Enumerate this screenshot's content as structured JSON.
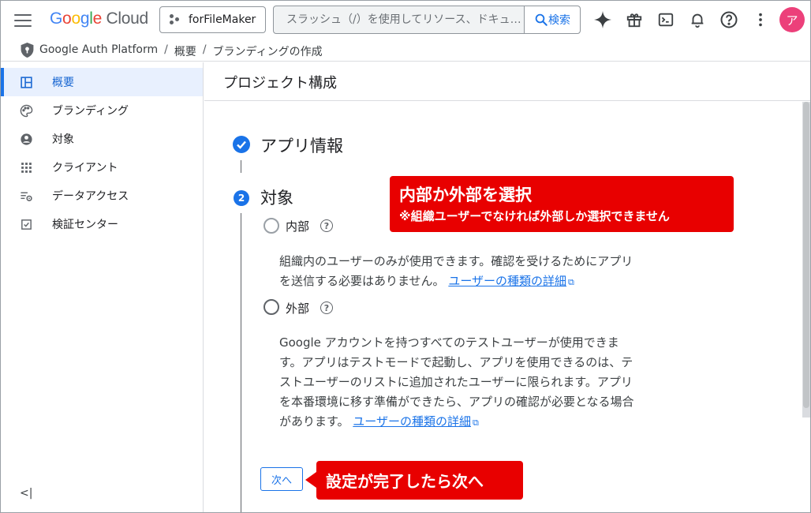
{
  "header": {
    "logo_google": "Google",
    "logo_cloud": "Cloud",
    "project_name": "forFileMaker",
    "search_placeholder": "スラッシュ（/）を使用してリソース、ドキュ…",
    "search_button": "検索",
    "avatar_letter": "ア"
  },
  "breadcrumb": [
    "Google Auth Platform",
    "概要",
    "ブランディングの作成"
  ],
  "sidebar": {
    "items": [
      {
        "label": "概要",
        "icon": "dashboard-icon",
        "active": true
      },
      {
        "label": "ブランディング",
        "icon": "palette-icon",
        "active": false
      },
      {
        "label": "対象",
        "icon": "person-circle-icon",
        "active": false
      },
      {
        "label": "クライアント",
        "icon": "grid-dots-icon",
        "active": false
      },
      {
        "label": "データアクセス",
        "icon": "data-settings-icon",
        "active": false
      },
      {
        "label": "検証センター",
        "icon": "check-box-icon",
        "active": false
      }
    ],
    "collapse_label": "<|"
  },
  "main": {
    "page_title": "プロジェクト構成",
    "step1_title": "アプリ情報",
    "step2_number": "2",
    "step2_title": "対象",
    "internal": {
      "label": "内部",
      "desc": "組織内のユーザーのみが使用できます。確認を受けるためにアプリを送信する必要はありません。",
      "link": "ユーザーの種類の詳細"
    },
    "external": {
      "label": "外部",
      "desc": "Google アカウントを持つすべてのテストユーザーが使用できます。アプリはテストモードで起動し、アプリを使用できるのは、テストユーザーのリストに追加されたユーザーに限られます。アプリを本番環境に移す準備ができたら、アプリの確認が必要となる場合があります。",
      "link": "ユーザーの種類の詳細"
    },
    "next_button": "次へ"
  },
  "callouts": {
    "main_title": "内部か外部を選択",
    "main_note": "※組織ユーザーでなければ外部しか選択できません",
    "next_hint": "設定が完了したら次へ"
  },
  "colors": {
    "accent": "#1a73e8",
    "callout": "#e80000",
    "avatar": "#ec407a"
  }
}
